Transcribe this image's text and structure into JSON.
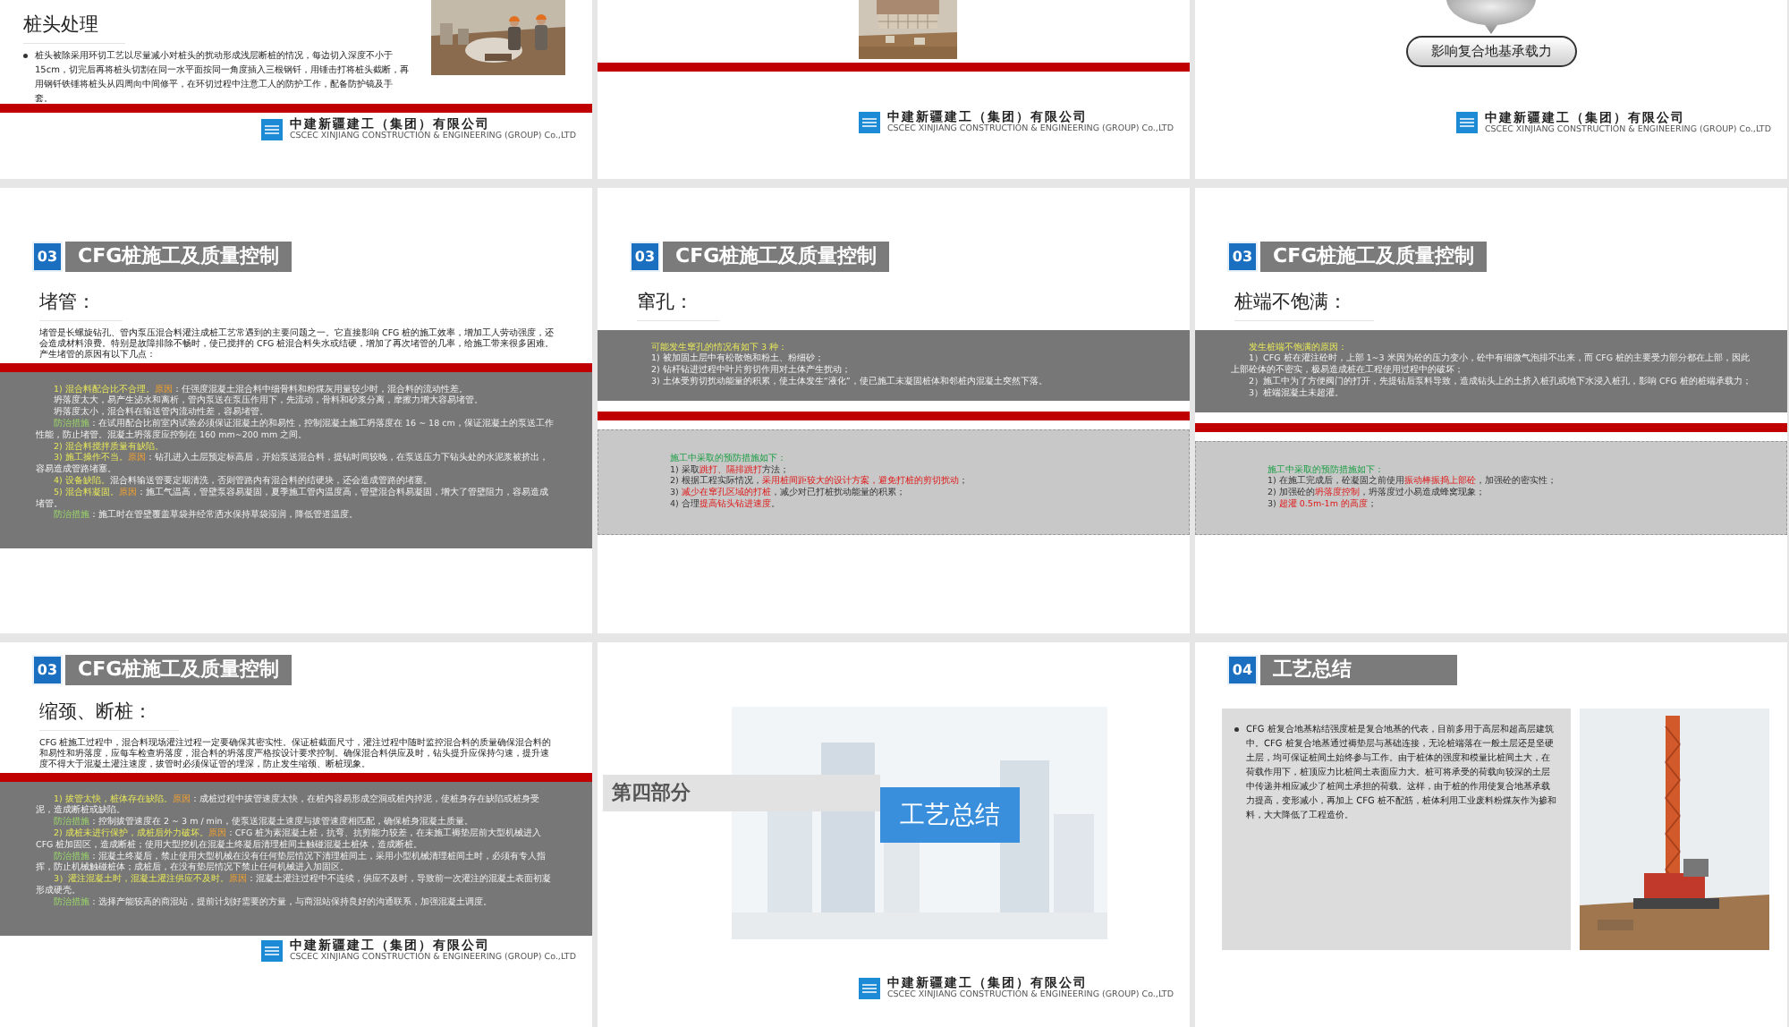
{
  "slides": [
    {
      "kind": "photo-text",
      "heading": "桩头处理",
      "bullets": [
        "桩头被除采用环切工艺以尽量减小对桩头的扰动形成浅层断桩的情况，每边切入深度不小于 15cm，切完后再将桩头切割在同一水平面按同一角度插入三根钢钎，用锤击打将桩头截断，再用钢钎铁锤将桩头从四周向中间修平，在环切过程中注意工人的防护工作，配备防护镜及手套。"
      ],
      "logo": {
        "name": "中建新疆建工（集团）有限公司",
        "name_en": "CSCEC XINJIANG CONSTRUCTION & ENGINEERING (GROUP) Co.,LTD"
      }
    },
    {
      "kind": "photo-banner",
      "logo": {
        "name": "中建新疆建工（集团）有限公司",
        "name_en": "CSCEC XINJIANG CONSTRUCTION & ENGINEERING (GROUP) Co.,LTD"
      }
    },
    {
      "kind": "diagram",
      "label": "影响复合地基承载力",
      "logo": {
        "name": "中建新疆建工（集团）有限公司",
        "name_en": "CSCEC XINJIANG CONSTRUCTION & ENGINEERING (GROUP) Co.,LTD"
      }
    },
    {
      "kind": "cfg-detail",
      "section_number": "03",
      "section_title": "CFG桩施工及质量控制",
      "heading": "堵管：",
      "intro": "堵管是长螺旋钻孔、管内泵压混合料灌注成桩工艺常遇到的主要问题之一。它直接影响 CFG 桩的施工效率，增加工人劳动强度，还会造成材料浪费。特别是故障排除不畅时，使已搅拌的 CFG 桩混合料失水或结硬，增加了再次堵管的几率，给施工带来很多困难。产生堵管的原因有以下几点：",
      "dark_box": [
        [
          {
            "text": "1) 混合料配合比不合理。",
            "kind": "yellow"
          },
          {
            "text": "原因",
            "kind": "orange"
          },
          {
            "text": "：任强度混凝土混合料中细骨料和粉煤灰用量较少时，混合料的流动性差。",
            "kind": "plain"
          }
        ],
        [
          {
            "text": "坍落度太大，易产生泌水和离析，管内泵送在泵压作用下，先流动，骨料和砂浆分离，摩擦力增大容易堵管。",
            "kind": "plain"
          }
        ],
        [
          {
            "text": "坍落度太小，混合料在输送管内流动性差，容易堵管。",
            "kind": "plain"
          }
        ],
        [
          {
            "text": "防治措施",
            "kind": "green"
          },
          {
            "text": "：在试用配合比前室内试验必须保证混凝土的和易性，控制混凝土施工坍落度在 16 ~ 18 cm，保证混凝土的泵送工作性能，防止堵管。混凝土坍落度应控制在 160 mm~200 mm 之间。",
            "kind": "plain"
          }
        ],
        [
          {
            "text": "2) 混合料搅拌质量有缺陷。",
            "kind": "yellow"
          }
        ],
        [
          {
            "text": "3) 施工操作不当。",
            "kind": "yellow"
          },
          {
            "text": "原因",
            "kind": "orange"
          },
          {
            "text": "：钻孔进入土层预定标高后，开始泵送混合料，提钻时间较晚，在泵送压力下钻头处的水泥浆被挤出，容易造成管路堵塞。",
            "kind": "plain"
          }
        ],
        [
          {
            "text": "4) 设备缺陷。",
            "kind": "yellow"
          },
          {
            "text": "混合料输送管要定期清洗，否则管路内有混合料的结硬块，还会造成管路的堵塞。",
            "kind": "plain"
          }
        ],
        [
          {
            "text": "5) 混合料凝固。",
            "kind": "yellow"
          },
          {
            "text": "原因",
            "kind": "orange"
          },
          {
            "text": "：施工气温高，管壁泵容易凝固，夏季施工管内温度高，管壁混合料易凝固，增大了管壁阻力，容易造成堵管。",
            "kind": "plain"
          }
        ],
        [
          {
            "text": "防治措施",
            "kind": "green"
          },
          {
            "text": "：施工时在管壁覆盖草袋并经常洒水保持草袋湿润，降低管道温度。",
            "kind": "plain"
          }
        ]
      ]
    },
    {
      "kind": "cfg-detail",
      "section_number": "03",
      "section_title": "CFG桩施工及质量控制",
      "heading": "窜孔：",
      "dark_box": [
        [
          {
            "text": "可能发生窜孔的情况有如下 3 种：",
            "kind": "yellow"
          }
        ],
        [
          {
            "text": "1) 被加固土层中有松散饱和粉土、粉细砂；",
            "kind": "plain"
          }
        ],
        [
          {
            "text": "2) 钻杆钻进过程中叶片剪切作用对土体产生扰动；",
            "kind": "plain"
          }
        ],
        [
          {
            "text": "3) 土体受剪切扰动能量的积累，使土体发生“液化”，使已施工未凝固桩体和邻桩内混凝土突然下落。",
            "kind": "plain"
          }
        ]
      ],
      "light_box": [
        [
          {
            "text": "施工中采取的预防措施如下：",
            "kind": "green"
          }
        ],
        [
          {
            "text": "1) 采取",
            "kind": "plain"
          },
          {
            "text": "跳打、隔排跳打",
            "kind": "red"
          },
          {
            "text": "方法；",
            "kind": "plain"
          }
        ],
        [
          {
            "text": "2) 根据工程实际情况，",
            "kind": "plain"
          },
          {
            "text": "采用桩间距较大的设计方案，避免打桩的剪切扰动",
            "kind": "red"
          },
          {
            "text": "；",
            "kind": "plain"
          }
        ],
        [
          {
            "text": "3) ",
            "kind": "plain"
          },
          {
            "text": "减少在窜孔区域的打桩",
            "kind": "red"
          },
          {
            "text": "，减少对已打桩扰动能量的积累；",
            "kind": "plain"
          }
        ],
        [
          {
            "text": "4) 合理",
            "kind": "plain"
          },
          {
            "text": "提高钻头钻进速度",
            "kind": "red"
          },
          {
            "text": "。",
            "kind": "plain"
          }
        ]
      ]
    },
    {
      "kind": "cfg-detail",
      "section_number": "03",
      "section_title": "CFG桩施工及质量控制",
      "heading": "桩端不饱满：",
      "dark_box": [
        [
          {
            "text": "发生桩端不饱满的原因：",
            "kind": "yellow"
          }
        ],
        [
          {
            "text": "1）CFG 桩在灌注砼时，上部 1~3 米因为砼的压力变小，砼中有细微气泡排不出来，而 CFG 桩的主要受力部分都在上部，因此上部砼体的不密实，极易造成桩在工程使用过程中的破坏；",
            "kind": "plain"
          }
        ],
        [
          {
            "text": "2）施工中为了方便阀门的打开，先提钻后泵料导致，造成钻头上的土挤入桩孔或地下水浸入桩孔，影响 CFG 桩的桩端承载力；",
            "kind": "plain"
          }
        ],
        [
          {
            "text": "3）桩端混凝土未超灌。",
            "kind": "plain"
          }
        ]
      ],
      "light_box": [
        [
          {
            "text": "施工中采取的预防措施如下：",
            "kind": "green"
          }
        ],
        [
          {
            "text": "1) 在施工完成后，砼凝固之前使用",
            "kind": "plain"
          },
          {
            "text": "振动棒振捣上部砼",
            "kind": "red"
          },
          {
            "text": "，加强砼的密实性；",
            "kind": "plain"
          }
        ],
        [
          {
            "text": "2) 加强砼的",
            "kind": "plain"
          },
          {
            "text": "坍落度控制",
            "kind": "red"
          },
          {
            "text": "，坍落度过小易造成蜂窝现象；",
            "kind": "plain"
          }
        ],
        [
          {
            "text": "3) ",
            "kind": "plain"
          },
          {
            "text": "超灌 0.5m-1m 的高度",
            "kind": "red"
          },
          {
            "text": "；",
            "kind": "plain"
          }
        ]
      ]
    },
    {
      "kind": "cfg-detail",
      "section_number": "03",
      "section_title": "CFG桩施工及质量控制",
      "heading": "缩颈、断桩：",
      "intro": "CFG 桩施工过程中，混合料现场灌注过程一定要确保其密实性。保证桩截面尺寸，灌注过程中随时监控混合料的质量确保混合料的和易性和坍落度，应每车检查坍落度，混合料的坍落度严格按设计要求控制。确保混合料供应及时，钻头提升应保持匀速，提升速度不得大于混凝土灌注速度，拔管时必须保证管的埋深，防止发生缩颈、断桩现象。",
      "dark_box": [
        [
          {
            "text": "1) 拔管太快，桩体存在缺陷。",
            "kind": "yellow"
          },
          {
            "text": "原因",
            "kind": "orange"
          },
          {
            "text": "：成桩过程中拔管速度太快，在桩内容易形成空洞或桩内掉泥，使桩身存在缺陷或桩身受泥，造成断桩或缺陷。",
            "kind": "plain"
          }
        ],
        [
          {
            "text": "防治措施",
            "kind": "green"
          },
          {
            "text": "：控制拔管速度在 2 ~ 3 m / min，使泵送混凝土速度与拔管速度相匹配，确保桩身混凝土质量。",
            "kind": "plain"
          }
        ],
        [
          {
            "text": "2) 成桩未进行保护，成桩后外力破坏。",
            "kind": "yellow"
          },
          {
            "text": "原因",
            "kind": "orange"
          },
          {
            "text": "：CFG 桩为素混凝土桩，抗弯、抗剪能力较差，在未施工褥垫层前大型机械进入 CFG 桩加固区，造成断桩；使用大型挖机在混凝土终凝后清理桩间土触碰混凝土桩体，造成断桩。",
            "kind": "plain"
          }
        ],
        [
          {
            "text": "防治措施",
            "kind": "green"
          },
          {
            "text": "：混凝土终凝后，禁止使用大型机械在没有任何垫层情况下清理桩间土，采用小型机械清理桩间土时，必须有专人指挥，防止机械触碰桩体；成桩后，在没有垫层情况下禁止任何机械进入加固区。",
            "kind": "plain"
          }
        ],
        [
          {
            "text": "3）灌注混凝土时，混凝土灌注供应不及时。",
            "kind": "yellow"
          },
          {
            "text": "原因",
            "kind": "orange"
          },
          {
            "text": "：混凝土灌注过程中不连续，供应不及时，导致前一次灌注的混凝土表面初凝形成硬壳。",
            "kind": "plain"
          }
        ],
        [
          {
            "text": "防治措施",
            "kind": "green"
          },
          {
            "text": "：选择产能较高的商混站，提前计划好需要的方量，与商混站保持良好的沟通联系，加强混凝土调度。",
            "kind": "plain"
          }
        ]
      ],
      "logo": {
        "name": "中建新疆建工（集团）有限公司",
        "name_en": "CSCEC XINJIANG CONSTRUCTION & ENGINEERING (GROUP) Co.,LTD"
      }
    },
    {
      "kind": "section-divider",
      "part": "第四部分",
      "title": "工艺总结",
      "logo": {
        "name": "中建新疆建工（集团）有限公司",
        "name_en": "CSCEC XINJIANG CONSTRUCTION & ENGINEERING (GROUP) Co.,LTD"
      }
    },
    {
      "kind": "summary",
      "section_number": "04",
      "section_title": "工艺总结",
      "bullets": [
        "CFG 桩复合地基粘结强度桩是复合地基的代表，目前多用于高层和超高层建筑中。CFG 桩复合地基通过褥垫层与基础连接，无论桩端落在一般土层还是坚硬土层，均可保证桩间土始终参与工作。由于桩体的强度和模量比桩间土大，在荷载作用下，桩顶应力比桩间土表面应力大。桩可将承受的荷载向较深的土层中传递并相应减少了桩间土承担的荷载。这样，由于桩的作用使复合地基承载力提高，变形减小，再加上 CFG 桩不配筋，桩体利用工业废料粉煤灰作为掺和料，大大降低了工程造价。"
      ]
    }
  ]
}
